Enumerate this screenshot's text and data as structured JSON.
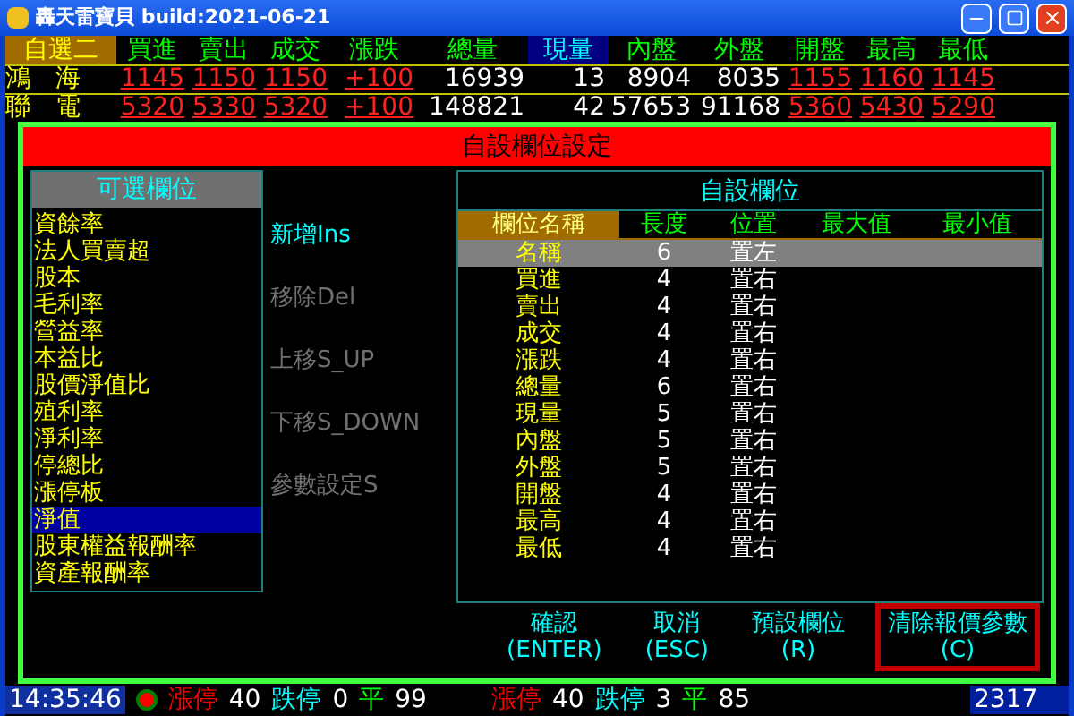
{
  "window": {
    "title": "轟天雷寶貝 build:2021-06-21"
  },
  "quote_table": {
    "columns": [
      {
        "label": "自選二",
        "kind": "group"
      },
      {
        "label": "買進",
        "kind": "price",
        "selected": false
      },
      {
        "label": "賣出",
        "kind": "price",
        "selected": false
      },
      {
        "label": "成交",
        "kind": "price",
        "selected": false
      },
      {
        "label": "漲跌",
        "kind": "price",
        "selected": false
      },
      {
        "label": "總量",
        "kind": "volume",
        "selected": false
      },
      {
        "label": "現量",
        "kind": "volume",
        "selected": true
      },
      {
        "label": "內盤",
        "kind": "volume",
        "selected": false
      },
      {
        "label": "外盤",
        "kind": "volume",
        "selected": false
      },
      {
        "label": "開盤",
        "kind": "price",
        "selected": false
      },
      {
        "label": "最高",
        "kind": "price",
        "selected": false
      },
      {
        "label": "最低",
        "kind": "price",
        "selected": false
      }
    ],
    "rows": [
      {
        "cells": [
          "鴻　海",
          "1145",
          "1150",
          "1150",
          "+100",
          "16939",
          "13",
          "8904",
          "8035",
          "1155",
          "1160",
          "1145"
        ]
      },
      {
        "cells": [
          "聯　電",
          "5320",
          "5330",
          "5320",
          "+100",
          "148821",
          "42",
          "57653",
          "91168",
          "5360",
          "5430",
          "5290"
        ]
      }
    ]
  },
  "dialog": {
    "title": "自設欄位設定",
    "available": {
      "title": "可選欄位",
      "items": [
        {
          "label": "資餘率",
          "selected": false
        },
        {
          "label": "法人買賣超",
          "selected": false
        },
        {
          "label": "股本",
          "selected": false
        },
        {
          "label": "毛利率",
          "selected": false
        },
        {
          "label": "營益率",
          "selected": false
        },
        {
          "label": "本益比",
          "selected": false
        },
        {
          "label": "股價淨值比",
          "selected": false
        },
        {
          "label": "殖利率",
          "selected": false
        },
        {
          "label": "淨利率",
          "selected": false
        },
        {
          "label": "停總比",
          "selected": false
        },
        {
          "label": "漲停板",
          "selected": false
        },
        {
          "label": "淨值",
          "selected": true
        },
        {
          "label": "股東權益報酬率",
          "selected": false
        },
        {
          "label": "資產報酬率",
          "selected": false
        }
      ]
    },
    "actions": [
      {
        "label": "新增Ins",
        "disabled": false
      },
      {
        "label": "移除Del",
        "disabled": true
      },
      {
        "label": "上移S_UP",
        "disabled": true
      },
      {
        "label": "下移S_DOWN",
        "disabled": true
      },
      {
        "label": "參數設定S",
        "disabled": true
      }
    ],
    "custom": {
      "title": "自設欄位",
      "columns": [
        {
          "label": "欄位名稱",
          "selected": true
        },
        {
          "label": "長度",
          "selected": false
        },
        {
          "label": "位置",
          "selected": false
        },
        {
          "label": "最大值",
          "selected": false
        },
        {
          "label": "最小值",
          "selected": false
        }
      ],
      "rows": [
        {
          "name": "名稱",
          "length": "6",
          "position": "置左",
          "selected": true
        },
        {
          "name": "買進",
          "length": "4",
          "position": "置右",
          "selected": false
        },
        {
          "name": "賣出",
          "length": "4",
          "position": "置右",
          "selected": false
        },
        {
          "name": "成交",
          "length": "4",
          "position": "置右",
          "selected": false
        },
        {
          "name": "漲跌",
          "length": "4",
          "position": "置右",
          "selected": false
        },
        {
          "name": "總量",
          "length": "6",
          "position": "置右",
          "selected": false
        },
        {
          "name": "現量",
          "length": "5",
          "position": "置右",
          "selected": false
        },
        {
          "name": "內盤",
          "length": "5",
          "position": "置右",
          "selected": false
        },
        {
          "name": "外盤",
          "length": "5",
          "position": "置右",
          "selected": false
        },
        {
          "name": "開盤",
          "length": "4",
          "position": "置右",
          "selected": false
        },
        {
          "name": "最高",
          "length": "4",
          "position": "置右",
          "selected": false
        },
        {
          "name": "最低",
          "length": "4",
          "position": "置右",
          "selected": false
        }
      ]
    },
    "buttons": [
      {
        "label": "確認",
        "key": "(ENTER)",
        "focused": false
      },
      {
        "label": "取消",
        "key": "(ESC)",
        "focused": false
      },
      {
        "label": "預設欄位",
        "key": "(R)",
        "focused": false
      },
      {
        "label": "清除報價參數",
        "key": "(C)",
        "focused": true
      }
    ]
  },
  "status_bar": {
    "time": "14:35:46",
    "items": [
      {
        "text": "漲停",
        "color": "#ff0000"
      },
      {
        "text": "40",
        "color": "#ffffff"
      },
      {
        "text": "跌停",
        "color": "#00ffff"
      },
      {
        "text": "0",
        "color": "#ffffff"
      },
      {
        "text": "平",
        "color": "#00ff00"
      },
      {
        "text": "99",
        "color": "#ffffff"
      },
      {
        "text": "漲停",
        "color": "#ff0000"
      },
      {
        "text": "40",
        "color": "#ffffff"
      },
      {
        "text": "跌停",
        "color": "#00ffff"
      },
      {
        "text": "3",
        "color": "#ffffff"
      },
      {
        "text": "平",
        "color": "#00ff00"
      },
      {
        "text": "85",
        "color": "#ffffff"
      }
    ],
    "index": "2317"
  }
}
